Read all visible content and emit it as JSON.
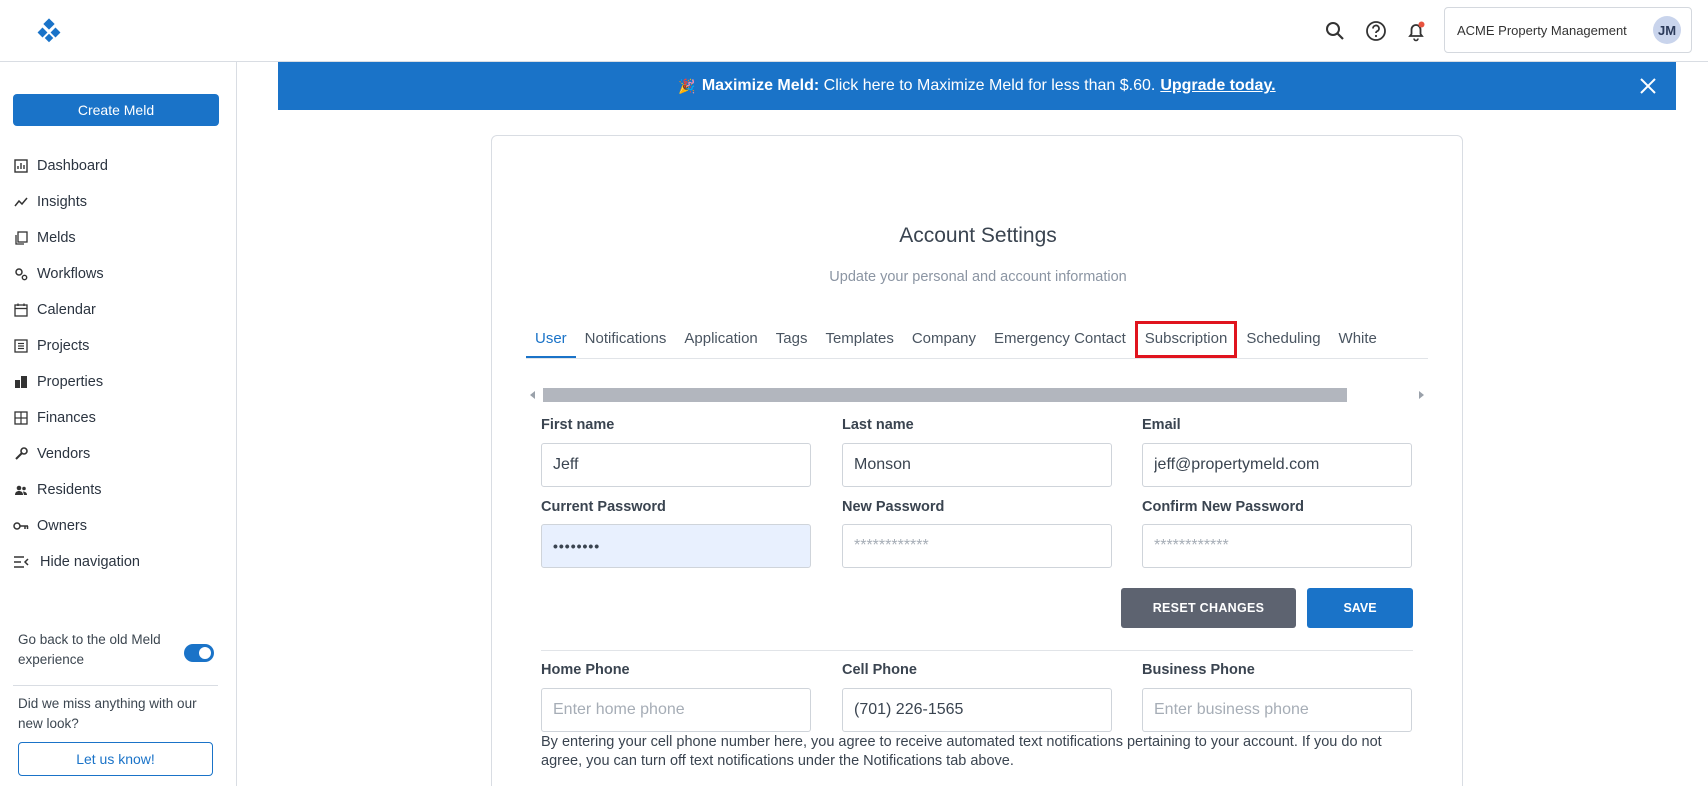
{
  "topbar": {
    "account_name": "ACME Property Management",
    "avatar_initials": "JM",
    "notification_dot_color": "#e8533f"
  },
  "sidebar": {
    "create_label": "Create Meld",
    "items": [
      {
        "label": "Dashboard",
        "icon": "dashboard-icon"
      },
      {
        "label": "Insights",
        "icon": "insights-icon"
      },
      {
        "label": "Melds",
        "icon": "melds-icon"
      },
      {
        "label": "Workflows",
        "icon": "workflows-icon"
      },
      {
        "label": "Calendar",
        "icon": "calendar-icon"
      },
      {
        "label": "Projects",
        "icon": "projects-icon"
      },
      {
        "label": "Properties",
        "icon": "properties-icon"
      },
      {
        "label": "Finances",
        "icon": "finances-icon"
      },
      {
        "label": "Vendors",
        "icon": "vendors-icon"
      },
      {
        "label": "Residents",
        "icon": "residents-icon"
      },
      {
        "label": "Owners",
        "icon": "owners-icon"
      },
      {
        "label": "Hide navigation",
        "icon": "hide-navigation-icon"
      }
    ],
    "old_meld_text": "Go back to the old Meld experience",
    "miss_text": "Did we miss anything with our new look?",
    "letus_label": "Let us know!"
  },
  "banner": {
    "emoji": "🎉",
    "bold_text": "Maximize Meld:",
    "text": " Click here to Maximize Meld for less than $.60.",
    "link_text": "Upgrade today."
  },
  "account": {
    "title": "Account Settings",
    "subtitle": "Update your personal and account information",
    "tabs": [
      "User",
      "Notifications",
      "Application",
      "Tags",
      "Templates",
      "Company",
      "Emergency Contact",
      "Subscription",
      "Scheduling",
      "White"
    ],
    "active_tab": "User",
    "highlighted_tab": "Subscription",
    "fields": {
      "first_name": {
        "label": "First name",
        "value": "Jeff"
      },
      "last_name": {
        "label": "Last name",
        "value": "Monson"
      },
      "email": {
        "label": "Email",
        "value": "jeff@propertymeld.com"
      },
      "current_password": {
        "label": "Current Password",
        "value": "••••••••"
      },
      "new_password": {
        "label": "New Password",
        "placeholder": "************"
      },
      "confirm_password": {
        "label": "Confirm New Password",
        "placeholder": "************"
      },
      "home_phone": {
        "label": "Home Phone",
        "placeholder": "Enter home phone"
      },
      "cell_phone": {
        "label": "Cell Phone",
        "value": "(701) 226-1565"
      },
      "business_phone": {
        "label": "Business Phone",
        "placeholder": "Enter business phone"
      }
    },
    "reset_label": "RESET CHANGES",
    "save_label": "SAVE",
    "disclaimer": "By entering your cell phone number here, you agree to receive automated text notifications pertaining to your account. If you do not agree, you can turn off text notifications under the Notifications tab above."
  },
  "colors": {
    "primary": "#1a73c8",
    "highlight": "#e0141e",
    "reset_button": "#5d6370"
  }
}
